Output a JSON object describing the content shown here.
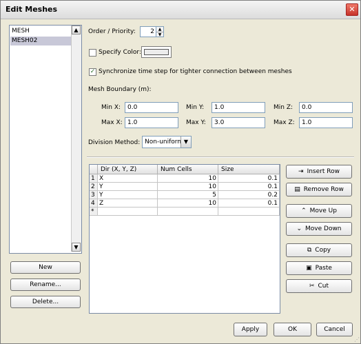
{
  "window": {
    "title": "Edit Meshes",
    "close_icon": "close-icon"
  },
  "meshes": {
    "items": [
      "MESH",
      "MESH02"
    ],
    "selected_index": 1
  },
  "list_buttons": {
    "new": "New",
    "rename": "Rename...",
    "delete": "Delete..."
  },
  "order": {
    "label": "Order / Priority:",
    "value": "2"
  },
  "specify_color": {
    "label": "Specify Color:",
    "checked": false,
    "swatch": "#ececec"
  },
  "sync": {
    "label": "Synchronize time step for tighter connection between meshes",
    "checked": true
  },
  "boundary": {
    "label": "Mesh Boundary (m):",
    "min_x_label": "Min X:",
    "min_x": "0.0",
    "min_y_label": "Min Y:",
    "min_y": "1.0",
    "min_z_label": "Min Z:",
    "min_z": "0.0",
    "max_x_label": "Max X:",
    "max_x": "1.0",
    "max_y_label": "Max Y:",
    "max_y": "3.0",
    "max_z_label": "Max Z:",
    "max_z": "1.0"
  },
  "division": {
    "label": "Division Method:",
    "value": "Non-uniform"
  },
  "table": {
    "headers": [
      "Dir (X, Y, Z)",
      "Num Cells",
      "Size"
    ],
    "rows": [
      {
        "n": "1",
        "dir": "X",
        "cells": "10",
        "size": "0.1"
      },
      {
        "n": "2",
        "dir": "Y",
        "cells": "10",
        "size": "0.1"
      },
      {
        "n": "3",
        "dir": "Y",
        "cells": "5",
        "size": "0.2"
      },
      {
        "n": "4",
        "dir": "Z",
        "cells": "10",
        "size": "0.1"
      }
    ],
    "new_row_marker": "*"
  },
  "table_buttons": {
    "insert_row": "Insert Row",
    "remove_row": "Remove Row",
    "move_up": "Move Up",
    "move_down": "Move Down",
    "copy": "Copy",
    "paste": "Paste",
    "cut": "Cut"
  },
  "footer": {
    "apply": "Apply",
    "ok": "OK",
    "cancel": "Cancel"
  }
}
